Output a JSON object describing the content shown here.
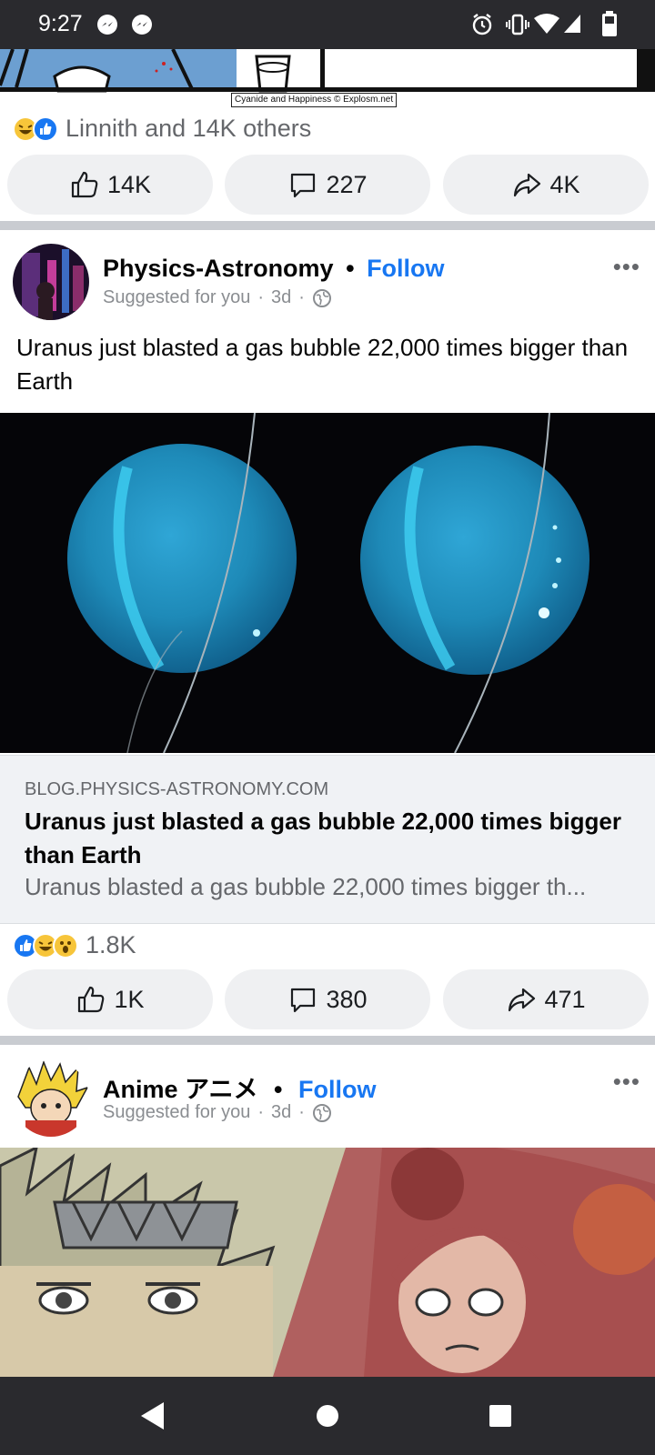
{
  "status_bar": {
    "time": "9:27",
    "left_icons": [
      "messenger-icon",
      "messenger-icon"
    ],
    "right_icons": [
      "alarm-icon",
      "vibrate-icon",
      "wifi-icon",
      "signal-icon",
      "battery-icon"
    ]
  },
  "previous_post": {
    "image_credit": "Cyanide and Happiness © Explosm.net",
    "reactions_text": "Linnith and 14K others",
    "actions": {
      "like": "14K",
      "comment": "227",
      "share": "4K"
    }
  },
  "physics_post": {
    "page_name": "Physics-Astronomy",
    "separator": "•",
    "follow_label": "Follow",
    "meta": {
      "label": "Suggested for you",
      "sep": "·",
      "age": "3d",
      "audience_icon": "globe-icon"
    },
    "more_label": "•••",
    "text": "Uranus just blasted a gas bubble 22,000 times bigger than Earth",
    "link": {
      "domain": "BLOG.PHYSICS-ASTRONOMY.COM",
      "title": "Uranus just blasted a gas bubble 22,000 times bigger than Earth",
      "description": "Uranus blasted a gas bubble 22,000 times bigger th..."
    },
    "reactions_count": "1.8K",
    "actions": {
      "like": "1K",
      "comment": "380",
      "share": "471"
    }
  },
  "anime_post": {
    "page_name": "Anime アニメ",
    "separator": "•",
    "follow_label": "Follow",
    "meta": {
      "label": "Suggested for you",
      "sep": "·",
      "age": "3d",
      "audience_icon": "globe-icon"
    },
    "more_label": "•••"
  },
  "colors": {
    "accent": "#1877f2",
    "pill_bg": "#eff0f2",
    "separator": "#c9ccd1",
    "system_bar": "#2a2a2e"
  },
  "nav_bar": {
    "icons": [
      "back-icon",
      "home-icon",
      "recents-icon"
    ]
  }
}
